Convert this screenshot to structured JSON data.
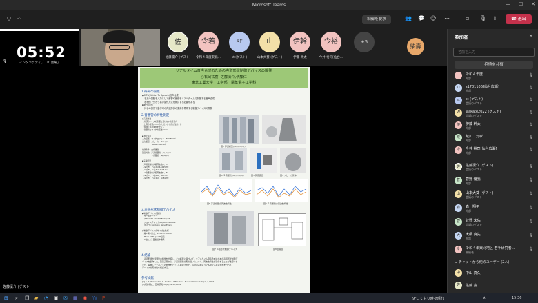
{
  "window": {
    "title": "Microsoft Teams",
    "minimize": "—",
    "maximize": "☐",
    "close": "✕"
  },
  "toolbar": {
    "dots": "-:-",
    "raise_request": "制御を要求",
    "leave": "退出"
  },
  "clock_tile": {
    "time": "05:52",
    "sub": "インタラクティブ「P1会場」"
  },
  "participants_strip": [
    {
      "initial": "佐",
      "name": "佐藤凜介 (ゲスト)",
      "color": "#e6e8c8"
    },
    {
      "initial": "令若",
      "name": "令和４年度東北...",
      "color": "#f2c3c0"
    },
    {
      "initial": "st",
      "name": "st (ゲスト)",
      "color": "#b8c9ef"
    },
    {
      "initial": "山",
      "name": "山本大葵 (ゲスト)",
      "color": "#f3e0a8"
    },
    {
      "initial": "伊幹",
      "name": "伊藤 幹太",
      "color": "#f2c3c0"
    },
    {
      "initial": "今裕",
      "name": "今井 裕司[仙台...",
      "color": "#f2c3c0"
    }
  ],
  "more_count": "+5",
  "sho_initial": "柴壽",
  "poster": {
    "title_line1": "リアルタイム音声合成のための声道形状制御デバイスの開発",
    "title_line2": "○石岡祐樹, 佐藤凜介,伊藤仁",
    "title_line3": "東北工業大学　工学部　電気電子工学科",
    "s1_title": "1.研究の背景",
    "s1_text": [
      "●MTS(Motion To Speech)音声合成",
      "・手足の運動を入力として音響や音色をリアルタイムで制御する音声合成",
      "・表現的で分かり易い操作方法を検討する必要がある",
      "●研究目的",
      "・片手の操作で動作可の声道形状の変化を再現する制御デバイスの開発"
    ],
    "s2_title": "2.音響管の特性測定",
    "s2_text": [
      "●実験方法",
      "・外部のノイズの影響を受けない防音室内",
      "・上側の音源[7mmの穴]ガタから音が放射する",
      "　筐体に各音響管をセット",
      "・音響管とマイクの距離10cm",
      "",
      "●測定装置",
      "入力装置：マイクロフォン（ECM8000）",
      "出力装置：スピーカーユニット",
      "　　　　　（NSW2-326-8A）",
      "",
      "収録条件：白色雑音",
      "測定対象：声道音響管　/a/,/e/,/o/",
      "　　　　　２音響管　/a/,/e/,/o/",
      "",
      "●実験結果",
      "・声道模型の共振周波数F₁、F₂",
      "　/a/のF₁、F₂はd576,1125 Hz",
      "　/e/のF₁、F₂は319,2103 Hz",
      "・２音響管の共振周波数F₁、F₂",
      "　/a/のF₁、F₂は644、925 Hz",
      "　/e/のF₁、F₂は257、1781 Hz"
    ],
    "fig1": "図1 声道模型(/a/,/i/,u,/o/)",
    "fig2": "図2 ２音響管(/a/,/i/,u,/o/)",
    "fig3": "図3 測定装置",
    "fig4": "図4 スピーカ筐体",
    "fig5": "図5 声道模型の周波数特性",
    "fig6": "図6 ２音響管の周波数特性",
    "s3_title": "3.声道形状制御デバイス",
    "s3_text": [
      "●制御デバイスの製作",
      "・サーボモーター",
      "　(PTA2840-20150PB103)×8",
      "・ジョイスティック(RKJXM1015004)",
      "・マイコン(Arduino Nano Every)",
      "",
      "●制御デバイスのサイズと仕様",
      "・縦×横×高さ：65×65×180mm",
      "・Micro USB Type-B接続",
      "・2軸による自動操作機構"
    ],
    "fig7": "図7 声道形状制御デバイス",
    "fig8": "図8 回路図",
    "s4_title": "4.結論",
    "s4_text": [
      "・声道形状や音響管の特性を比較し、その結果に基づいて、リアルタイム音声合成のための声道形状制御デ",
      "バイスを製作した。測定実験から、声道音響管の形の違いによって、周波数特性が変化することが確認でき",
      "また、開発したデバイスの動作をテストし確認された。今後は実際にリアルタイム音声合成を行って、",
      "デバイスの有効性を検証する。"
    ],
    "s5_title": "参考文献",
    "s5_text": [
      "[1] S. S. Fels and G. E. Hinton : IEEE Trans. Neural Network 10(1),7,1992.",
      "[2]石井翔太：石井研究 50(1),31-38,2001."
    ]
  },
  "stage_name": "佐藤凜介 (ゲスト)",
  "panel": {
    "title": "参加者",
    "search_placeholder": "名前を入力",
    "share_invite": "招待を共有",
    "participants": [
      {
        "initial": "",
        "name": "令和４年度...",
        "role": "外部",
        "color": "#f2c3c0"
      },
      {
        "initial": "s1",
        "name": "s1701106[仙台広瀬]",
        "role": "外部",
        "color": "#c5d6f2"
      },
      {
        "initial": "st",
        "name": "st (ゲスト)",
        "role": "会議のゲスト",
        "color": "#b8c9ef"
      },
      {
        "initial": "W",
        "name": "wakate2022 (ゲスト)",
        "role": "会議のゲスト",
        "color": "#f3e0a8"
      },
      {
        "initial": "伊",
        "name": "伊藤 幹太",
        "role": "外部",
        "color": "#f2c3c0"
      },
      {
        "initial": "荒",
        "name": "荒川　元孝",
        "role": "外部",
        "color": "#c8e6c9"
      },
      {
        "initial": "今",
        "name": "今井 裕司[仙台広瀬]",
        "role": "外部",
        "color": "#f2c3c0"
      },
      {
        "initial": "佐",
        "name": "佐藤凜介 (ゲスト)",
        "role": "会議のゲスト",
        "color": "#e6e8c8"
      },
      {
        "initial": "菅",
        "name": "菅野 優我",
        "role": "外部",
        "color": "#c8e6c9"
      },
      {
        "initial": "山",
        "name": "山本大葵 (ゲスト)",
        "role": "会議のゲスト",
        "color": "#f3e0a8"
      },
      {
        "initial": "森",
        "name": "森　翔平",
        "role": "外部",
        "color": "#c5d6f2"
      },
      {
        "initial": "菅",
        "name": "菅野 未佑",
        "role": "会議のゲスト",
        "color": "#c8e6c9"
      },
      {
        "initial": "大",
        "name": "大網 良矢",
        "role": "外部",
        "color": "#c5d6f2"
      },
      {
        "initial": "令",
        "name": "令和４年東北地区 若手研究者...",
        "role": "開催者",
        "color": "#f2c3c0"
      }
    ],
    "group_label": "チャットから他のユーザー (2人)",
    "others": [
      {
        "initial": "中",
        "name": "中山 真久",
        "role": "",
        "color": "#f3e0a8"
      },
      {
        "initial": "佐",
        "name": "佐藤 寛",
        "role": "",
        "color": "#e6e8c8"
      }
    ]
  },
  "taskbar": {
    "weather": "9°C くもり時々晴れ",
    "ime": "A",
    "time": "15:36"
  }
}
